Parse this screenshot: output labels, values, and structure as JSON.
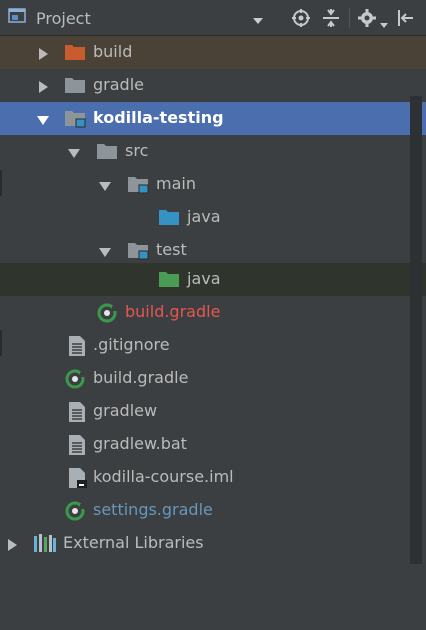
{
  "header": {
    "title": "Project",
    "icons": [
      "project-view-icon",
      "dropdown-icon",
      "locate-icon",
      "collapse-all-icon",
      "settings-gear-icon",
      "hide-panel-icon"
    ]
  },
  "tree": [
    {
      "label": "build",
      "icon": "folder-excluded-icon",
      "expanded": false
    },
    {
      "label": "gradle",
      "icon": "folder-icon",
      "expanded": false
    },
    {
      "label": "kodilla-testing",
      "icon": "module-folder-icon",
      "expanded": true
    },
    {
      "label": "src",
      "icon": "folder-icon",
      "expanded": true
    },
    {
      "label": "main",
      "icon": "source-root-folder-icon",
      "expanded": true
    },
    {
      "label": "java",
      "icon": "source-folder-icon"
    },
    {
      "label": "test",
      "icon": "test-root-folder-icon",
      "expanded": true
    },
    {
      "label": "java",
      "icon": "test-source-folder-icon"
    },
    {
      "label": "build.gradle",
      "icon": "gradle-file-icon"
    },
    {
      "label": ".gitignore",
      "icon": "text-file-icon"
    },
    {
      "label": "build.gradle",
      "icon": "gradle-file-icon"
    },
    {
      "label": "gradlew",
      "icon": "text-file-icon"
    },
    {
      "label": "gradlew.bat",
      "icon": "text-file-icon"
    },
    {
      "label": "kodilla-course.iml",
      "icon": "iml-file-icon"
    },
    {
      "label": "settings.gradle",
      "icon": "gradle-file-icon"
    },
    {
      "label": "External Libraries",
      "icon": "libraries-icon",
      "expanded": false
    }
  ],
  "colors": {
    "background": "#3c3f41",
    "selection": "#4b6eaf",
    "excluded_folder": "#c75c2e",
    "source_folder": "#3592c4",
    "test_folder": "#499c54",
    "modified_red": "#e5574e",
    "link_blue": "#6897bb"
  }
}
